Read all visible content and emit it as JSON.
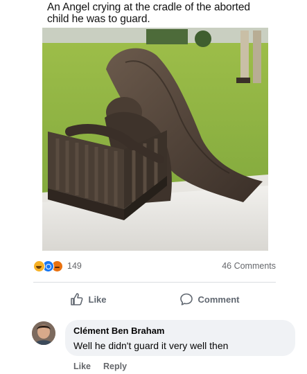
{
  "post": {
    "caption": "An Angel crying at the cradle of the aborted child he was to guard.",
    "image_icon": "angel-statue-photo"
  },
  "stats": {
    "reaction_icons": [
      "haha-reaction-icon",
      "wow-reaction-icon",
      "angry-reaction-icon"
    ],
    "reaction_count": "149",
    "comments_count": "46 Comments"
  },
  "actions": {
    "like_label": "Like",
    "comment_label": "Comment"
  },
  "comment": {
    "author": "Clément Ben Braham",
    "text": "Well he didn't guard it very well then",
    "like_label": "Like",
    "reply_label": "Reply"
  },
  "colors": {
    "muted_text": "#65676b",
    "bubble_bg": "#f0f2f5",
    "divider": "#dadde1"
  }
}
